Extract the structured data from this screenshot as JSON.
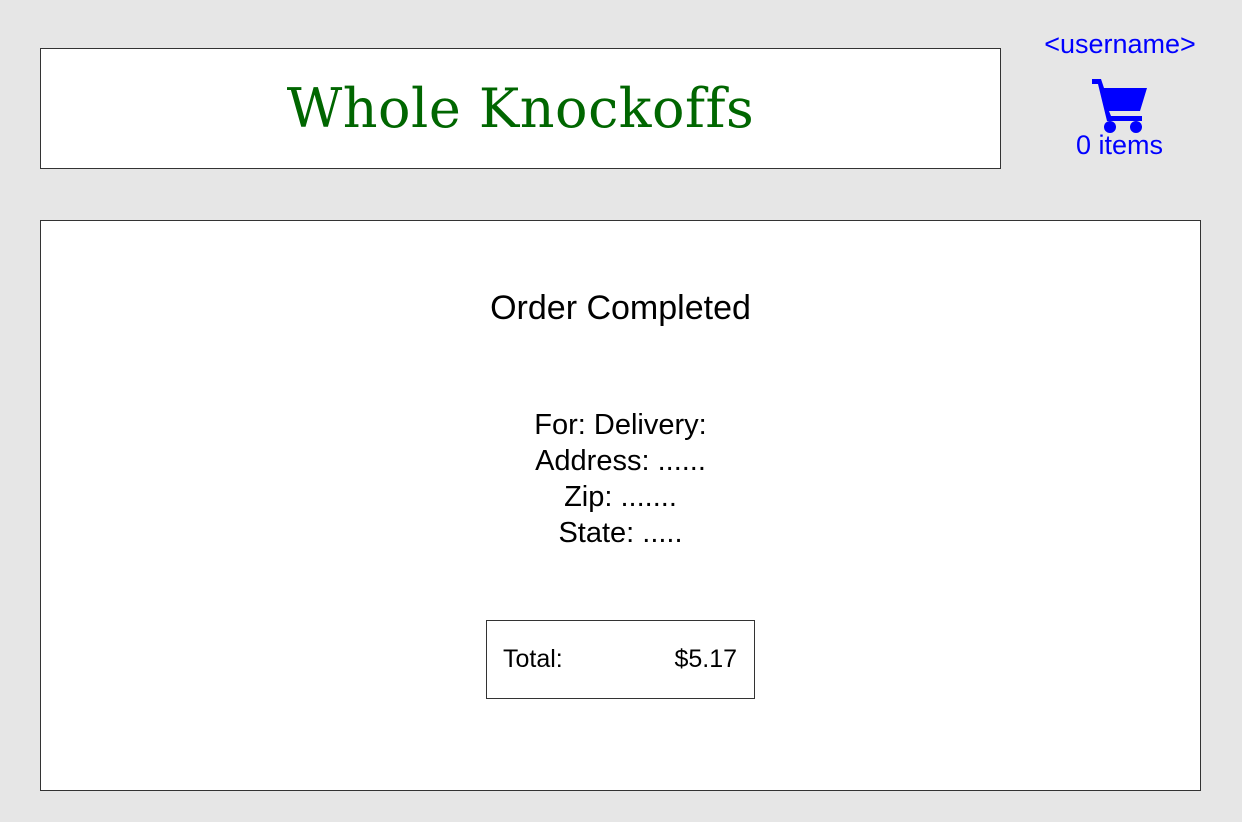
{
  "header": {
    "site_title": "Whole Knockoffs"
  },
  "user": {
    "username": "<username>",
    "cart_icon": "shopping-cart-icon",
    "cart_count": "0 items"
  },
  "order": {
    "title": "Order Completed",
    "details": [
      "For: Delivery:",
      "Address: ......",
      "Zip: .......",
      "State: ....."
    ],
    "total_label": "Total:",
    "total_value": "$5.17"
  },
  "colors": {
    "page_background": "#e6e6e6",
    "title_green": "#006600",
    "link_blue": "#0000ff"
  }
}
